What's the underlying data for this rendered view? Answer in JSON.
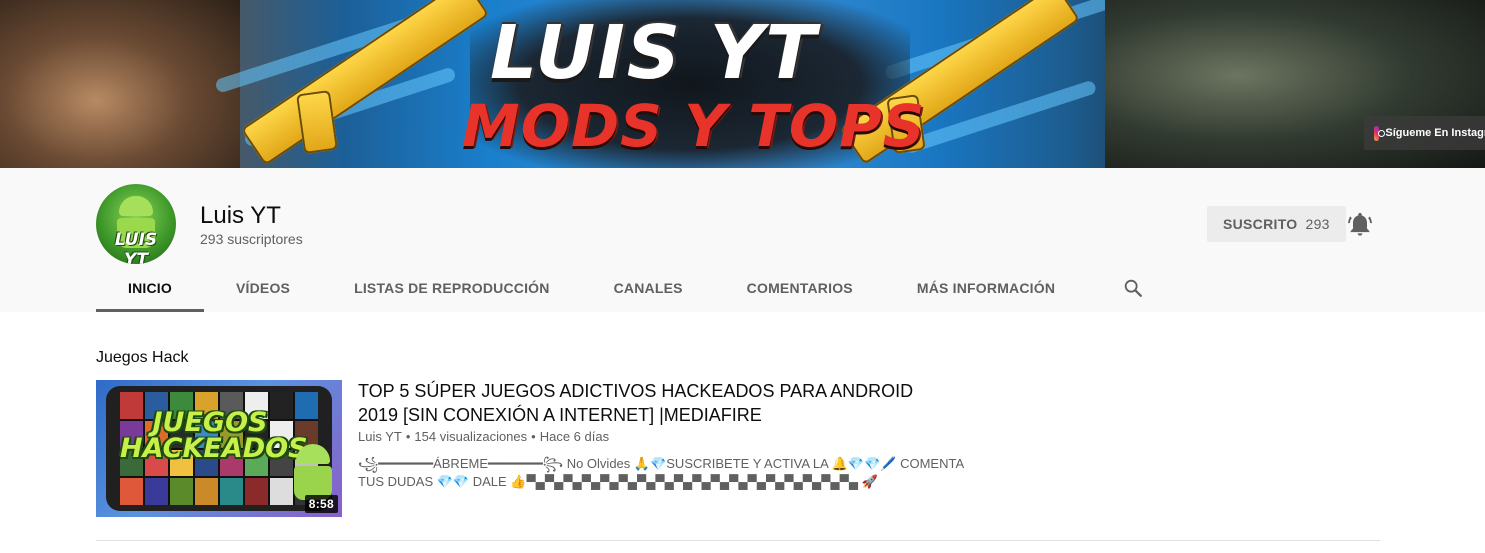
{
  "banner": {
    "title_line1": "LUIS YT",
    "title_line2": "MODS Y TOPS",
    "instagram_label": "Sígueme En Instagram"
  },
  "channel": {
    "avatar_text": "LUIS YT",
    "name": "Luis YT",
    "subscribers": "293 suscriptores",
    "subscribe_label": "SUSCRITO",
    "subscribe_count": "293"
  },
  "tabs": [
    {
      "label": "INICIO",
      "active": true
    },
    {
      "label": "VÍDEOS"
    },
    {
      "label": "LISTAS DE REPRODUCCIÓN"
    },
    {
      "label": "CANALES"
    },
    {
      "label": "COMENTARIOS"
    },
    {
      "label": "MÁS INFORMACIÓN"
    }
  ],
  "icons": {
    "bell": "bell-icon",
    "search": "search-icon",
    "instagram": "instagram-icon"
  },
  "shelf": {
    "title": "Juegos Hack"
  },
  "video": {
    "thumb_text": "JUEGOS HACKEADOS",
    "duration": "8:58",
    "title": "TOP 5 SÚPER JUEGOS ADICTIVOS HACKEADOS PARA ANDROID 2019 [SIN CONEXIÓN A INTERNET] |MEDIAFIRE",
    "channel": "Luis YT",
    "views": "154 visualizaciones",
    "age": "Hace 6 días",
    "description": "꧁━━━━━━━ÁBREME━━━━━━━꧂ No Olvides 🙏💎SUSCRIBETE Y ACTIVA LA 🔔💎💎🖊️ COMENTA TUS DUDAS 💎💎 DALE 👍▀▄▀▄▀▄▀▄▀▄▀▄▀▄▀▄▀▄▀▄▀▄▀▄▀▄▀▄▀▄▀▄▀▄▀▄ 🚀"
  },
  "colors": {
    "header_bg": "#f9f9f9",
    "text_primary": "#0d0d0d",
    "text_secondary": "#606060",
    "subscribed_bg": "#ececec",
    "divider": "#e0e0e0"
  }
}
